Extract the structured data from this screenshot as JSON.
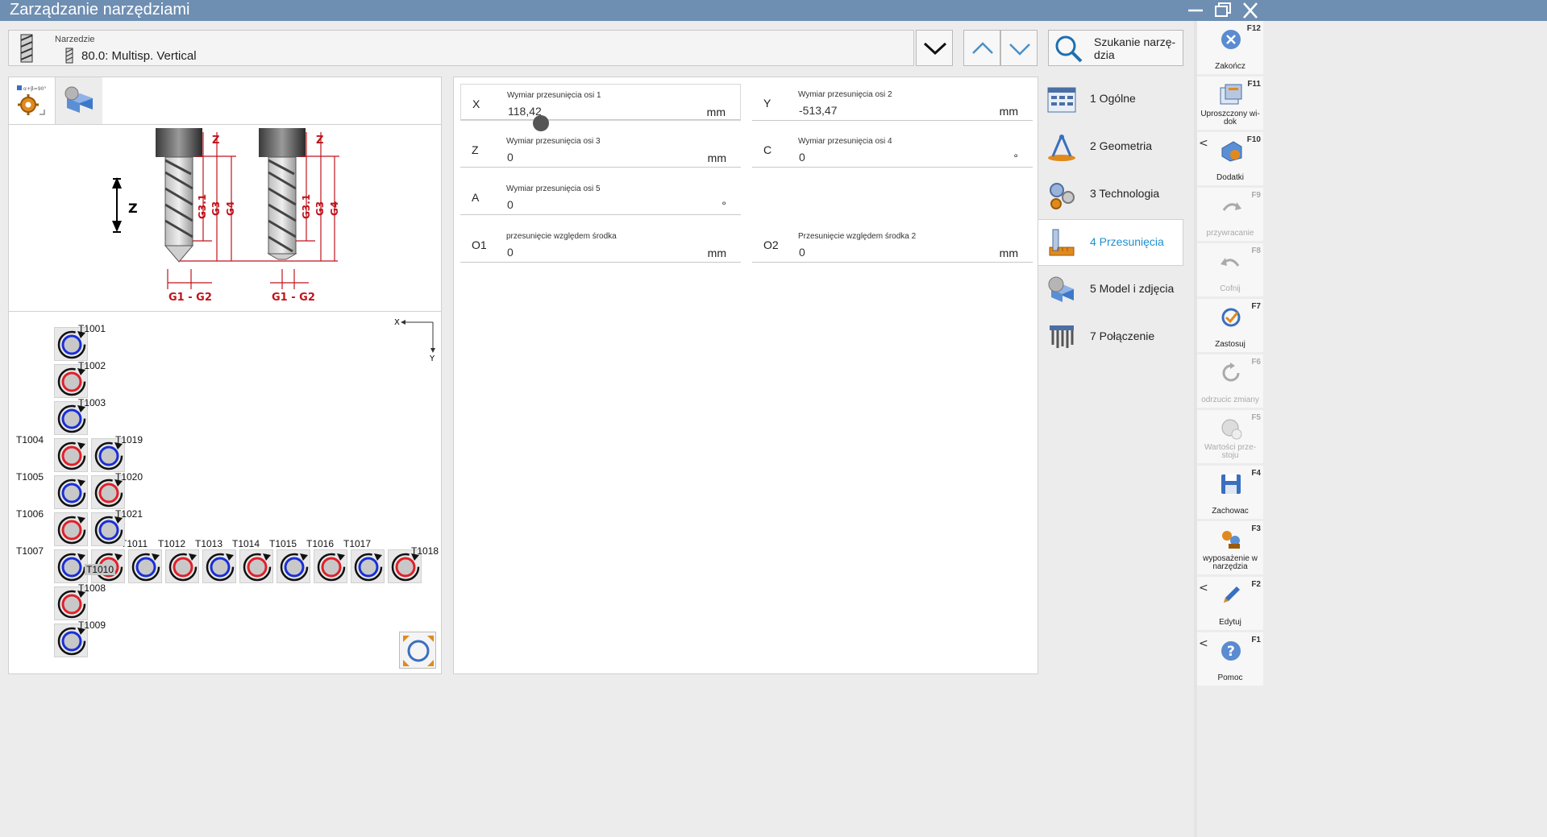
{
  "window": {
    "title": "Zarządzanie narzędziami"
  },
  "tool_header": {
    "label": "Narzedzie",
    "value": "80.0: Multisp. Vertical",
    "search_label": "Szukanie narzę-dzia"
  },
  "diagram": {
    "axis_label": "Z",
    "dim_z": "Z",
    "dim_g31": "G3.1",
    "dim_g3": "G3",
    "dim_g4": "G4",
    "dim_g1g2": "G1 - G2"
  },
  "magazine": {
    "axis_x": "X",
    "axis_y": "Y",
    "tools": [
      {
        "label": "T1001",
        "color": "blue"
      },
      {
        "label": "T1002",
        "color": "red"
      },
      {
        "label": "T1003",
        "color": "blue"
      },
      {
        "label": "T1004",
        "color": "red"
      },
      {
        "label": "T1005",
        "color": "blue"
      },
      {
        "label": "T1006",
        "color": "red"
      },
      {
        "label": "T1007",
        "color": "blue"
      },
      {
        "label": "T1008",
        "color": "red"
      },
      {
        "label": "T1009",
        "color": "blue"
      },
      {
        "label": "T1010",
        "color": "red"
      },
      {
        "label": "T1011",
        "color": "blue"
      },
      {
        "label": "T1012",
        "color": "red"
      },
      {
        "label": "T1013",
        "color": "blue"
      },
      {
        "label": "T1014",
        "color": "red"
      },
      {
        "label": "T1015",
        "color": "blue"
      },
      {
        "label": "T1016",
        "color": "red"
      },
      {
        "label": "T1017",
        "color": "blue"
      },
      {
        "label": "T1018",
        "color": "red"
      },
      {
        "label": "T1019",
        "color": "blue"
      },
      {
        "label": "T1020",
        "color": "red"
      },
      {
        "label": "T1021",
        "color": "blue"
      }
    ]
  },
  "fields": [
    {
      "axis": "X",
      "label": "Wymiar przesunięcia osi 1",
      "value": "118,42",
      "unit": "mm"
    },
    {
      "axis": "Y",
      "label": "Wymiar przesunięcia osi 2",
      "value": "-513,47",
      "unit": "mm"
    },
    {
      "axis": "Z",
      "label": "Wymiar przesunięcia osi 3",
      "value": "0",
      "unit": "mm"
    },
    {
      "axis": "C",
      "label": "Wymiar przesunięcia osi 4",
      "value": "0",
      "unit": "°"
    },
    {
      "axis": "A",
      "label": "Wymiar przesunięcia osi 5",
      "value": "0",
      "unit": "°"
    },
    {
      "axis": "O1",
      "label": "przesunięcie względem środka",
      "value": "0",
      "unit": "mm"
    },
    {
      "axis": "O2",
      "label": "Przesunięcie względem środka 2",
      "value": "0",
      "unit": "mm"
    }
  ],
  "nav": [
    {
      "label": "1 Ogólne",
      "active": false
    },
    {
      "label": "2 Geometria",
      "active": false
    },
    {
      "label": "3 Technologia",
      "active": false
    },
    {
      "label": "4 Przesunięcia",
      "active": true
    },
    {
      "label": "5 Model i zdjęcia",
      "active": false
    },
    {
      "label": "7 Połączenie",
      "active": false
    }
  ],
  "softkeys": [
    {
      "key": "F12",
      "label": "Zakończ",
      "enabled": true,
      "icon": "close-circle-icon"
    },
    {
      "key": "F11",
      "label": "Uproszczony wi-dok",
      "enabled": true,
      "icon": "simplified-view-icon"
    },
    {
      "key": "F10",
      "label": "Dodatki",
      "enabled": true,
      "icon": "addons-icon"
    },
    {
      "key": "F9",
      "label": "przywracanie",
      "enabled": false,
      "icon": "redo-icon"
    },
    {
      "key": "F8",
      "label": "Cofnij",
      "enabled": false,
      "icon": "undo-icon"
    },
    {
      "key": "F7",
      "label": "Zastosuj",
      "enabled": true,
      "icon": "apply-icon"
    },
    {
      "key": "F6",
      "label": "odrzucic zmiany",
      "enabled": false,
      "icon": "discard-icon"
    },
    {
      "key": "F5",
      "label": "Wartości prze-stoju",
      "enabled": false,
      "icon": "default-values-icon"
    },
    {
      "key": "F4",
      "label": "Zachowac",
      "enabled": true,
      "icon": "save-icon"
    },
    {
      "key": "F3",
      "label": "wyposażenie w narzędzia",
      "enabled": true,
      "icon": "tooling-icon"
    },
    {
      "key": "F2",
      "label": "Edytuj",
      "enabled": true,
      "icon": "edit-icon"
    },
    {
      "key": "F1",
      "label": "Pomoc",
      "enabled": true,
      "icon": "help-icon"
    }
  ],
  "colors": {
    "titlebar": "#6e8eb2",
    "accent": "#1e8fd0",
    "dim_red": "#c0141c",
    "tool_blue": "#1a2fd6",
    "tool_red": "#e0202a"
  }
}
